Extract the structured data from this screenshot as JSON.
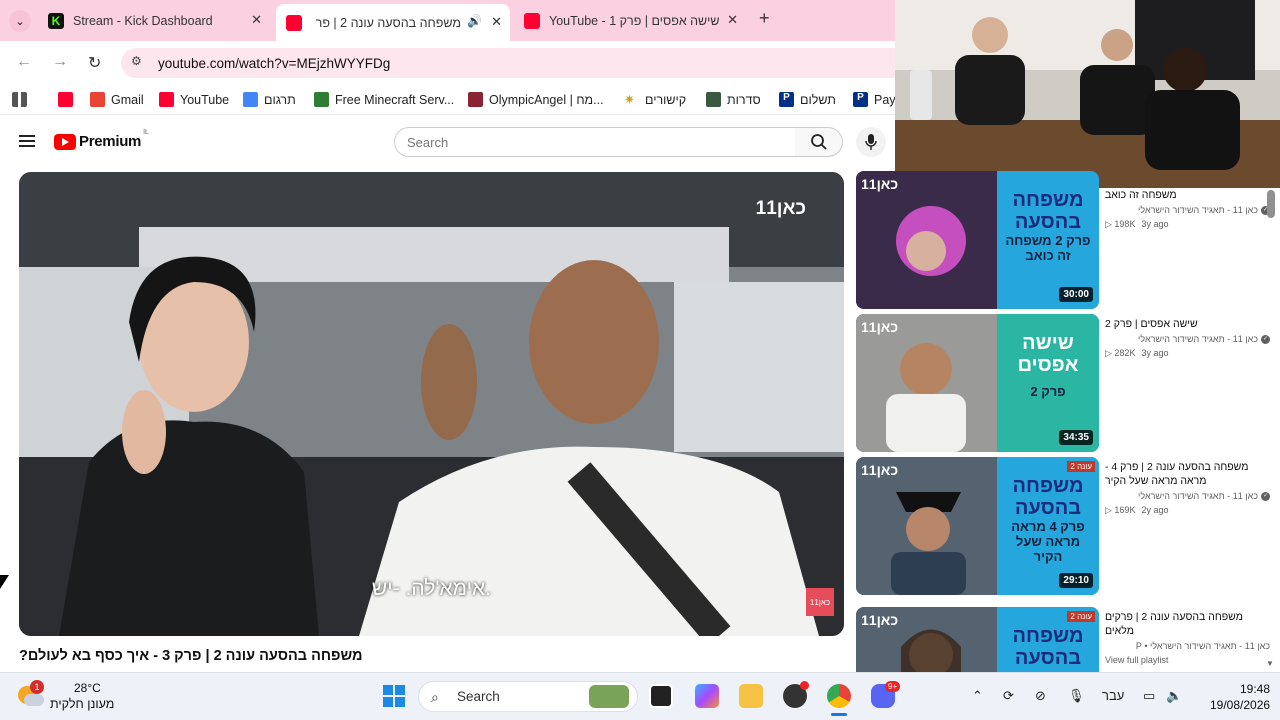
{
  "browser": {
    "tabs": [
      {
        "title": "Stream - Kick Dashboard",
        "favicon_color": "#53fc18"
      },
      {
        "title": "משפחה בהסעה עונה 2 | פר",
        "favicon_color": "#ff0033"
      },
      {
        "title": "YouTube - 1 שישה אפסים | פרק",
        "favicon_color": "#ff0033"
      }
    ],
    "url": "youtube.com/watch?v=MEjzhWYYFDg",
    "bookmarks": [
      "Gmail",
      "YouTube",
      "תרגום",
      "Free Minecraft Serv...",
      "OlympicAngel | מח...",
      "קישורים",
      "סדרות",
      "תשלום",
      "Payl"
    ]
  },
  "youtube": {
    "logo": "Premium",
    "logo_region": "IL",
    "search_placeholder": "Search",
    "video": {
      "channel_watermark": "כאן11",
      "subtitle": "אימא'לה. -יש.",
      "corner_badge": "כאן11",
      "title": "משפחה בהסעה עונה 2 | פרק 3 - איך כסף בא לעולם?"
    },
    "related": [
      {
        "title": "משפחה זה כואב",
        "channel": "כאן 11 - תאגיד השידור הישראלי",
        "views": "198K",
        "ago": "3y ago",
        "duration": "30:00",
        "poster_title": "משפחה בהסעה",
        "poster_sub": "פרק 2 משפחה זה כואב",
        "kan": "כאן11",
        "season": ""
      },
      {
        "title": "שישה אפסים | פרק 2",
        "channel": "כאן 11 - תאגיד השידור הישראלי",
        "views": "282K",
        "ago": "3y ago",
        "duration": "34:35",
        "poster_title": "שישה אפסים",
        "poster_sub": "פרק 2",
        "kan": "כאן11",
        "season": ""
      },
      {
        "title": "משפחה בהסעה עונה 2 | פרק 4 - מראה מראה שעל הקיר",
        "channel": "כאן 11 - תאגיד השידור הישראלי",
        "views": "169K",
        "ago": "2y ago",
        "duration": "29:10",
        "poster_title": "משפחה בהסעה",
        "poster_sub": "פרק 4 מראה מראה שעל הקיר",
        "kan": "כאן11",
        "season": "עונה 2"
      },
      {
        "title": "משפחה בהסעה עונה 2 | פרקים מלאים",
        "channel": "כאן 11 - תאגיד השידור הישראלי • P",
        "views": "View full playlist",
        "ago": "",
        "duration": "",
        "poster_title": "משפחה בהסעה",
        "poster_sub": "",
        "kan": "כאן11",
        "season": "עונה 2"
      }
    ]
  },
  "taskbar": {
    "weather_temp": "28°C",
    "weather_desc": "מעונן חלקית",
    "weather_badge": "1",
    "search": "Search",
    "lang": "עבר",
    "time": "19:48",
    "date": "19/08/2026",
    "discord_badge": "9+"
  }
}
